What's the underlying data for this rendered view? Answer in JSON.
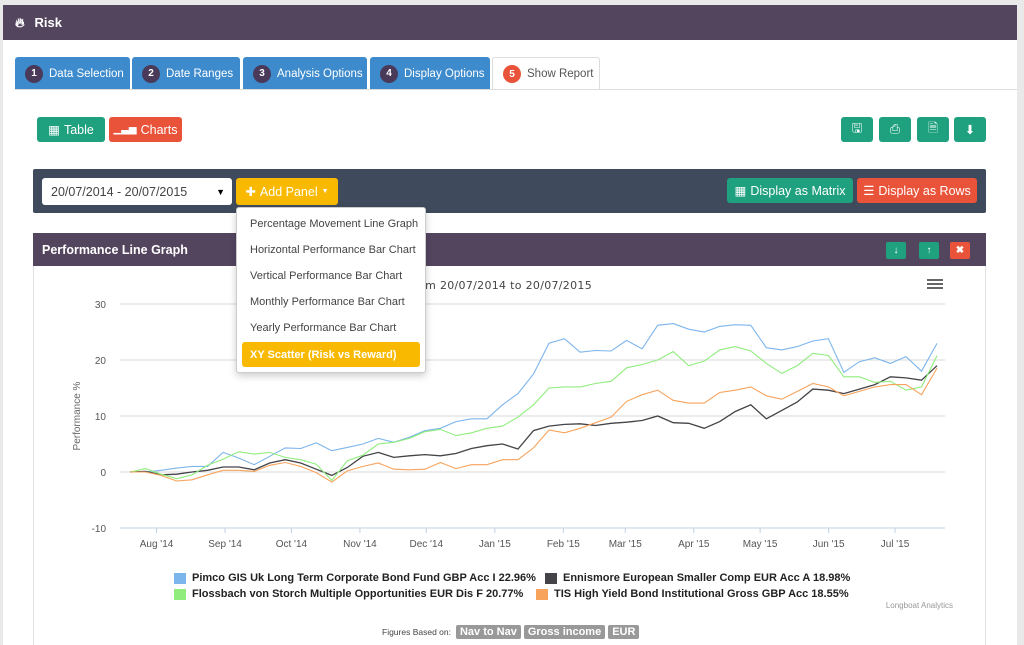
{
  "app": {
    "title": "Risk",
    "icon": "fire-icon"
  },
  "tabs": [
    {
      "num": "1",
      "label": "Data Selection"
    },
    {
      "num": "2",
      "label": "Date Ranges"
    },
    {
      "num": "3",
      "label": "Analysis Options"
    },
    {
      "num": "4",
      "label": "Display Options"
    },
    {
      "num": "5",
      "label": "Show Report",
      "active": true
    }
  ],
  "view": {
    "table_label": "Table",
    "charts_label": "Charts"
  },
  "actions": [
    "save-icon",
    "print-icon",
    "pdf-icon",
    "download-icon"
  ],
  "toolbar": {
    "date_range": "20/07/2014 - 20/07/2015",
    "add_panel": "Add Panel",
    "matrix": "Display as Matrix",
    "rows": "Display as Rows"
  },
  "menu": {
    "items": [
      "Percentage Movement Line Graph",
      "Horizontal Performance Bar Chart",
      "Vertical Performance Bar Chart",
      "Monthly Performance Bar Chart",
      "Yearly Performance Bar Chart",
      "XY Scatter (Risk vs Reward)"
    ],
    "selected": 5
  },
  "panel": {
    "title": "Performance Line Graph",
    "controls": [
      "arrow-down-icon",
      "arrow-up-icon",
      "close-icon"
    ]
  },
  "colors": {
    "purple": "#54455f",
    "blue_tab": "#3d8bcd",
    "green": "#1fa07f",
    "red": "#e8533a",
    "yellow": "#f8b900"
  },
  "chart_data": {
    "type": "line",
    "title": "from 20/07/2014 to 20/07/2015",
    "ylabel": "Performance %",
    "ylim": [
      -10,
      30
    ],
    "yticks": [
      -10,
      0,
      10,
      20,
      30
    ],
    "x_start": "2014-07-20",
    "x_end": "2015-07-20",
    "x_interval": "weekly",
    "xticks": [
      "Aug '14",
      "Sep '14",
      "Oct '14",
      "Nov '14",
      "Dec '14",
      "Jan '15",
      "Feb '15",
      "Mar '15",
      "Apr '15",
      "May '15",
      "Jun '15",
      "Jul '15"
    ],
    "grid": true,
    "legend": "bottom",
    "credit": "Longboat Analytics",
    "series": [
      {
        "name": "Pimco GIS Uk Long Term Corporate Bond Fund GBP Acc I 22.96%",
        "color": "#7cb5ec",
        "values": [
          0,
          0,
          0.3,
          0.7,
          1,
          1,
          3.5,
          2.5,
          1.3,
          2.8,
          4.3,
          4.2,
          5.2,
          3.8,
          4.4,
          5,
          6,
          5.3,
          6.2,
          7.4,
          7.8,
          9,
          9.5,
          9.5,
          12,
          14,
          17.5,
          23,
          23.8,
          21.4,
          21.7,
          21.6,
          23.5,
          22,
          26.2,
          26.5,
          25.5,
          25,
          26,
          26.3,
          26.2,
          22.2,
          21.8,
          22.4,
          23.4,
          23.8,
          17.8,
          19.7,
          20.4,
          19.4,
          20.6,
          18,
          22.96
        ]
      },
      {
        "name": "Ennismore European Smaller Comp EUR Acc A 18.98%",
        "color": "#434348",
        "values": [
          0,
          0.1,
          -0.5,
          -0.4,
          0,
          0.3,
          0.9,
          0.9,
          0.4,
          1.6,
          2.2,
          1.6,
          0.5,
          -0.6,
          0.8,
          2.8,
          3.5,
          2.6,
          2.9,
          3.1,
          2.9,
          3.3,
          4.2,
          4.7,
          5,
          4.1,
          7.4,
          8.2,
          8.5,
          8.6,
          8.3,
          8.7,
          8.9,
          9.2,
          10,
          8.8,
          8.7,
          7.8,
          9,
          10.8,
          12,
          9.5,
          11,
          12.5,
          14.8,
          14.6,
          14,
          14.8,
          15.6,
          17,
          16.8,
          16.4,
          18.98
        ]
      },
      {
        "name": "Flossbach von Storch Multiple Opportunities EUR Dis F 20.77%",
        "color": "#90ed7d",
        "values": [
          0,
          0.6,
          -0.4,
          -1.2,
          -0.5,
          1.2,
          2.3,
          3.6,
          3.2,
          3.5,
          2.6,
          2.2,
          1.4,
          -1.5,
          2,
          3,
          5,
          5.3,
          6,
          7.2,
          7.6,
          6.5,
          7,
          7.8,
          8.2,
          9.8,
          12,
          15,
          15.2,
          15.2,
          15.8,
          16.2,
          18.6,
          19.2,
          20,
          21.5,
          19,
          19.8,
          21.8,
          22.4,
          21.6,
          19.4,
          17.6,
          19,
          21.2,
          20.8,
          17,
          17,
          16,
          16.2,
          14.6,
          15.2,
          20.77
        ]
      },
      {
        "name": "TIS High Yield Bond Institutional Gross GBP Acc 18.55%",
        "color": "#f7a35c",
        "values": [
          0,
          0,
          -0.6,
          -1.6,
          -1.4,
          -0.5,
          0.3,
          0.3,
          0.1,
          1.2,
          1.7,
          1,
          -0.1,
          -1.8,
          0.2,
          1,
          1.6,
          0.5,
          0.4,
          0.5,
          1.7,
          0.6,
          1.3,
          1.3,
          2.2,
          2.2,
          4.3,
          7.5,
          7,
          7.8,
          8.8,
          9.8,
          12.6,
          13.8,
          14.6,
          12.8,
          12.3,
          12.3,
          14.2,
          14.6,
          15.2,
          13.6,
          13,
          14.4,
          15.8,
          15.2,
          13.6,
          14.4,
          15.2,
          15.6,
          15.6,
          13.8,
          18.55
        ]
      }
    ]
  },
  "footer": {
    "label": "Figures Based on:",
    "badges": [
      "Nav to Nav",
      "Gross income",
      "EUR"
    ]
  }
}
